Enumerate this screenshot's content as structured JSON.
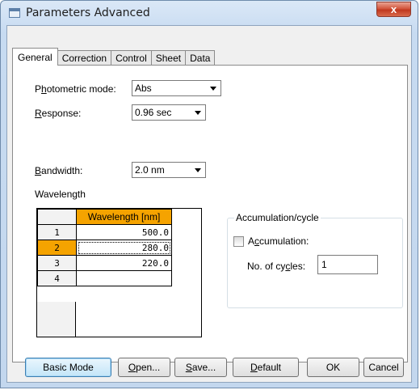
{
  "window": {
    "title": "Parameters Advanced",
    "close_glyph": "x",
    "icon": "window-app-icon"
  },
  "tabs": [
    {
      "label": "General",
      "active": true
    },
    {
      "label": "Correction",
      "active": false
    },
    {
      "label": "Control",
      "active": false
    },
    {
      "label": "Sheet",
      "active": false
    },
    {
      "label": "Data",
      "active": false
    }
  ],
  "general": {
    "photometric_mode": {
      "label_pre": "P",
      "label_u": "h",
      "label_post": "otometric mode:",
      "value": "Abs"
    },
    "response": {
      "label_u": "R",
      "label_post": "esponse:",
      "value": "0.96 sec"
    },
    "bandwidth": {
      "label_u": "B",
      "label_post": "andwidth:",
      "value": "2.0 nm"
    },
    "wavelength_label": "Wavelength",
    "grid": {
      "column_header": "Wavelength [nm]",
      "selected_row": 2,
      "rows": [
        {
          "index": "1",
          "value": "500.0"
        },
        {
          "index": "2",
          "value": "280.0"
        },
        {
          "index": "3",
          "value": "220.0"
        },
        {
          "index": "4",
          "value": ""
        }
      ]
    },
    "accumulation": {
      "group_title": "Accumulation/cycle",
      "checkbox_label_pre": "A",
      "checkbox_label_u": "c",
      "checkbox_label_post": "cumulation:",
      "checked": false,
      "cycles_label_pre": "No. of cy",
      "cycles_label_u": "c",
      "cycles_label_post": "les:",
      "cycles_value": "1"
    }
  },
  "buttons": {
    "basic_mode": "Basic Mode",
    "open": {
      "u": "O",
      "rest": "pen..."
    },
    "save": {
      "u": "S",
      "rest": "ave..."
    },
    "default": {
      "u": "D",
      "rest": "efault"
    },
    "ok": "OK",
    "cancel": "Cancel"
  },
  "colors": {
    "grid_highlight": "#f5a300",
    "default_button_border": "#3c7fb1",
    "close_button": "#c0391f"
  }
}
